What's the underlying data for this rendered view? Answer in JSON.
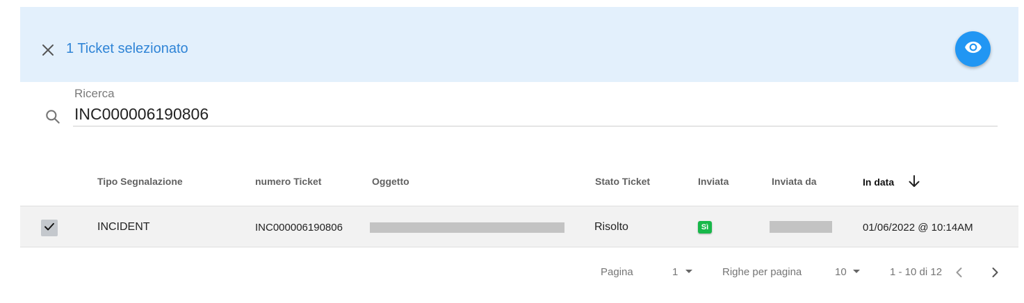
{
  "selection_bar": {
    "text": "1 Ticket selezionato",
    "close_icon": "close-icon",
    "view_icon": "eye-icon",
    "accent": "#2196f3",
    "background": "#e3f0fc"
  },
  "search": {
    "label": "Ricerca",
    "value": "INC000006190806",
    "icon": "search-icon"
  },
  "table": {
    "headers": {
      "tipo": "Tipo Segnalazione",
      "numero": "numero Ticket",
      "oggetto": "Oggetto",
      "stato": "Stato Ticket",
      "inviata": "Inviata",
      "inviata_da": "Inviata da",
      "in_data": "In data"
    },
    "sort": {
      "column": "In data",
      "direction": "descending",
      "icon": "arrow-down-icon"
    },
    "rows": [
      {
        "selected": true,
        "tipo": "INCIDENT",
        "numero": "INC000006190806",
        "oggetto": "",
        "stato": "Risolto",
        "inviata": "Sì",
        "inviata_da": "",
        "in_data": "01/06/2022 @ 10:14AM"
      }
    ]
  },
  "pagination": {
    "page_label": "Pagina",
    "page_value": "1",
    "rows_label": "Righe per pagina",
    "rows_value": "10",
    "range": "1 - 10 di 12"
  },
  "colors": {
    "badge_green": "#18b84a",
    "link_blue": "#2f84d6"
  }
}
